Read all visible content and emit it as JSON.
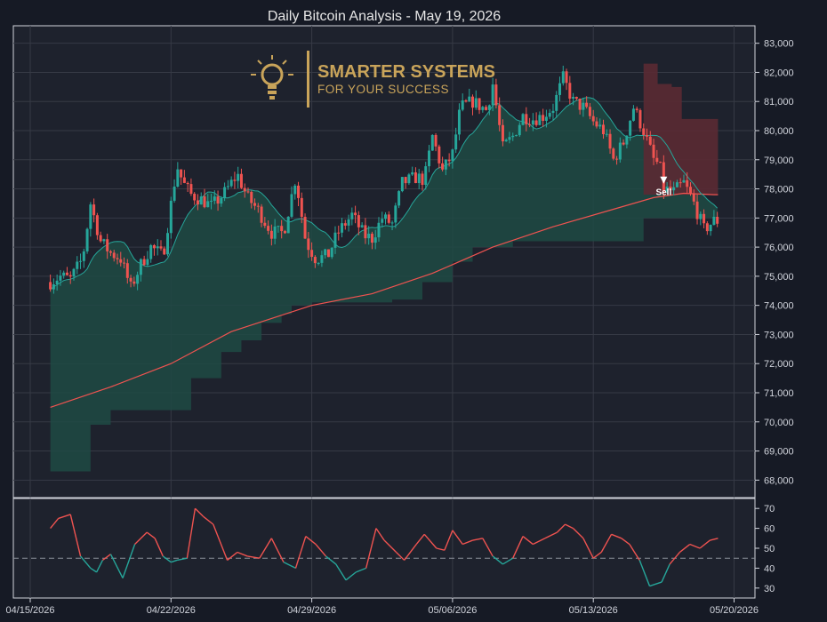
{
  "title": "Daily Bitcoin Analysis - May 19, 2026",
  "logo": {
    "line1": "SMARTER SYSTEMS",
    "line2": "FOR YOUR SUCCESS",
    "color": "#c9a45a"
  },
  "colors": {
    "background": "#161a25",
    "panel": "#1e222d",
    "grid": "#363a45",
    "up": "#26a69a",
    "down": "#ef5350",
    "cloud_up": "#1f4a44",
    "cloud_down": "#5a2a33",
    "ma_long": "#ef5350",
    "ma_short": "#26a69a"
  },
  "chart_data": [
    {
      "type": "candlestick",
      "ylim": [
        67400,
        83600
      ],
      "y_ticks": [
        68000,
        69000,
        70000,
        71000,
        72000,
        73000,
        74000,
        75000,
        76000,
        77000,
        78000,
        79000,
        80000,
        81000,
        82000,
        83000
      ],
      "y_tick_labels": [
        "68,000",
        "69,000",
        "70,000",
        "71,000",
        "72,000",
        "73,000",
        "74,000",
        "75,000",
        "76,000",
        "77,000",
        "78,000",
        "79,000",
        "80,000",
        "81,000",
        "82,000",
        "83,000"
      ],
      "x_ticks": [
        "04/15/2026",
        "04/22/2026",
        "04/29/2026",
        "05/06/2026",
        "05/13/2026",
        "05/20/2026"
      ],
      "x_tick_days": [
        0,
        7,
        14,
        21,
        28,
        35
      ],
      "x_range_days": [
        0.9,
        35.0
      ],
      "annotation": {
        "label": "Sell",
        "day": 31.5,
        "price": 78300
      },
      "close_anchors": {
        "day": [
          1.0,
          1.5,
          2.0,
          2.6,
          3.0,
          3.5,
          4.0,
          4.5,
          5.0,
          5.5,
          6.0,
          6.6,
          7.3,
          7.6,
          8.0,
          8.6,
          9.0,
          9.6,
          10.3,
          10.8,
          11.3,
          12.0,
          12.6,
          13.2,
          13.7,
          14.2,
          14.8,
          15.3,
          16.0,
          16.6,
          17.0,
          17.5,
          18.0,
          18.5,
          19.2,
          19.6,
          20.0,
          20.5,
          21.0,
          21.4,
          22.0,
          22.7,
          23.0,
          23.5,
          24.0,
          24.5,
          25.0,
          25.5,
          26.0,
          26.5,
          27.0,
          27.5,
          28.0,
          28.5,
          29.0,
          29.5,
          30.0,
          30.5,
          31.0,
          31.3,
          31.5,
          32.0,
          32.5,
          33.0,
          33.5,
          34.0,
          34.2
        ],
        "close": [
          74800,
          75000,
          74900,
          75600,
          77500,
          76200,
          75800,
          75600,
          74600,
          75400,
          76000,
          75700,
          78800,
          78200,
          77800,
          77600,
          77400,
          77800,
          78500,
          77700,
          77300,
          76500,
          76500,
          78400,
          76200,
          75600,
          75700,
          76500,
          77100,
          76400,
          76300,
          77000,
          76800,
          78200,
          78400,
          78300,
          79800,
          78600,
          79200,
          80800,
          81000,
          80700,
          81600,
          79400,
          79800,
          80500,
          80400,
          80500,
          80800,
          81800,
          81000,
          80800,
          80300,
          80000,
          79000,
          79600,
          80800,
          80000,
          79000,
          78800,
          78000,
          77900,
          78200,
          77500,
          76600,
          76900,
          76900
        ]
      },
      "ma_long": {
        "day": [
          1.0,
          4.0,
          7.0,
          10.0,
          14.0,
          17.0,
          20.0,
          23.0,
          26.0,
          29.0,
          31.0,
          32.5,
          34.0,
          34.2
        ],
        "value": [
          70500,
          71200,
          72000,
          73100,
          74000,
          74400,
          75100,
          76000,
          76700,
          77300,
          77700,
          77850,
          77800,
          77800
        ]
      },
      "cloud_lower": {
        "day": [
          1.0,
          2.0,
          3.0,
          4.0,
          5.0,
          7.0,
          8.0,
          9.5,
          10.5,
          11.5,
          12.5,
          13.0,
          14.0,
          18.0,
          19.5,
          21.0,
          22.0,
          24.0,
          27.0,
          29.0,
          30.5,
          34.2
        ],
        "value": [
          68300,
          68300,
          69900,
          70400,
          70400,
          70400,
          71500,
          72400,
          72800,
          73400,
          73700,
          74000,
          74100,
          74200,
          74800,
          75500,
          76000,
          76200,
          76200,
          76200,
          77000,
          77000
        ]
      },
      "red_cloud": {
        "start_day": 30.5,
        "end_day": 34.2,
        "upper": [
          82300,
          82300,
          81600,
          81500,
          80400,
          80400
        ],
        "upper_days": [
          30.5,
          30.8,
          31.2,
          31.9,
          32.4,
          34.2
        ],
        "lower": [
          77800,
          77800,
          77800,
          77800,
          77800,
          77800
        ]
      }
    },
    {
      "type": "line",
      "name": "",
      "ylim": [
        25,
        75
      ],
      "y_ticks": [
        30,
        40,
        50,
        60,
        70
      ],
      "reference_line": 45,
      "x_days": [
        1.0,
        1.4,
        2.0,
        2.5,
        3.0,
        3.3,
        3.6,
        4.0,
        4.6,
        5.2,
        5.8,
        6.2,
        6.6,
        7.0,
        7.3,
        7.8,
        8.2,
        8.6,
        9.1,
        9.8,
        10.3,
        10.8,
        11.4,
        12.0,
        12.6,
        13.2,
        13.7,
        14.2,
        14.7,
        15.2,
        15.7,
        16.2,
        16.7,
        17.2,
        17.6,
        18.2,
        18.6,
        19.2,
        19.6,
        20.2,
        20.6,
        21.0,
        21.5,
        22.0,
        22.5,
        23.0,
        23.5,
        24.0,
        24.5,
        25.0,
        25.6,
        26.2,
        26.6,
        27.0,
        27.5,
        28.0,
        28.4,
        28.9,
        29.4,
        29.8,
        30.3,
        30.8,
        31.4,
        31.8,
        32.3,
        32.8,
        33.3,
        33.8,
        34.2
      ],
      "values": [
        60,
        65,
        67,
        46,
        40,
        38,
        44,
        47,
        35,
        52,
        58,
        55,
        46,
        43,
        44,
        45,
        70,
        66,
        62,
        44,
        48,
        46,
        45,
        55,
        43,
        40,
        56,
        52,
        46,
        42,
        34,
        38,
        40,
        60,
        54,
        48,
        44,
        52,
        57,
        50,
        49,
        59,
        52,
        54,
        55,
        46,
        42,
        45,
        56,
        52,
        55,
        58,
        62,
        60,
        55,
        45,
        48,
        57,
        55,
        52,
        44,
        31,
        33,
        42,
        48,
        52,
        50,
        54,
        55
      ],
      "colors": {
        "above": "#ef5350",
        "below": "#26a69a",
        "reference": "#8a8f9a"
      }
    }
  ]
}
